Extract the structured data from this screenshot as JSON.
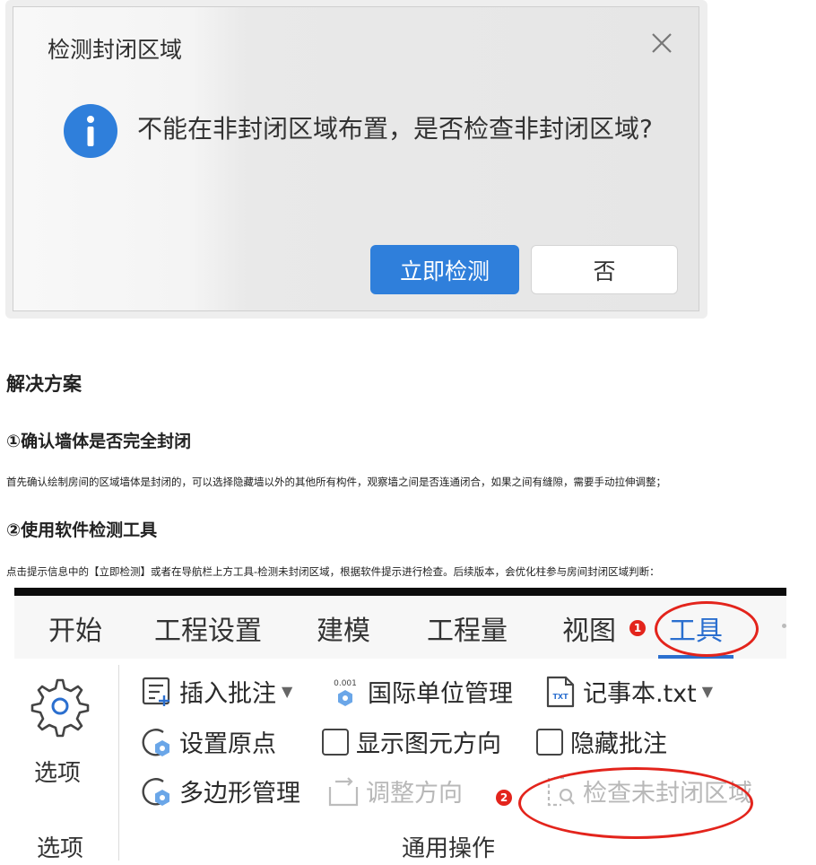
{
  "dialog": {
    "title": "检测封闭区域",
    "message": "不能在非封闭区域布置，是否检查非封闭区域?",
    "confirm_label": "立即检测",
    "cancel_label": "否",
    "info_icon": "info-icon",
    "close_icon": "close-icon",
    "accent_color": "#2f7fdb"
  },
  "article": {
    "heading": "解决方案",
    "step1_title": "①确认墙体是否完全封闭",
    "step1_text": "首先确认绘制房间的区域墙体是封闭的，可以选择隐藏墙以外的其他所有构件，观察墙之间是否连通闭合，如果之间有缝隙，需要手动拉伸调整；",
    "step2_title": "②使用软件检测工具",
    "step2_text": "点击提示信息中的【立即检测】或者在导航栏上方工具-检测未封闭区域，根据软件提示进行检查。后续版本，会优化柱参与房间封闭区域判断："
  },
  "ribbon": {
    "tabs": [
      "开始",
      "工程设置",
      "建模",
      "工程量",
      "视图",
      "工具"
    ],
    "active_tab": "工具",
    "options_button": "选项",
    "options_group": "选项",
    "general_group": "通用操作",
    "commands": {
      "insert_note": "插入批注",
      "unit_management": "国际单位管理",
      "unit_icon_text": "0.001",
      "notepad": "记事本.txt",
      "notepad_icon_text": "TXT",
      "set_origin": "设置原点",
      "show_direction": "显示图元方向",
      "hide_notes": "隐藏批注",
      "polygon_management": "多边形管理",
      "adjust_direction": "调整方向",
      "check_unclosed": "检查未封闭区域"
    },
    "annotation_1": "1",
    "annotation_2": "2",
    "highlight_color": "#e3241c"
  }
}
